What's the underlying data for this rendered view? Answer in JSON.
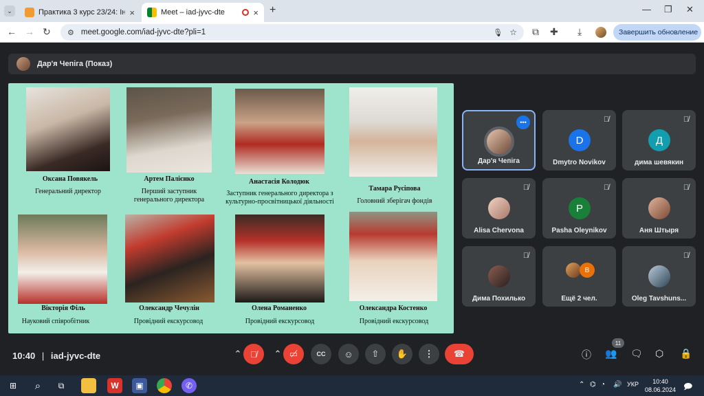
{
  "browser": {
    "tabs": [
      {
        "label": "Практика 3 курс 23/24: Індиві",
        "active": false
      },
      {
        "label": "Meet – iad-jyvc-dte",
        "active": true
      }
    ],
    "new_tab": "+",
    "address": "meet.google.com/iad-jyvc-dte?pli=1",
    "update_button": "Завершить обновление"
  },
  "meet": {
    "presenter_label": "Дар'я Чепіга (Показ)",
    "slide": {
      "background": "#9ee3cc",
      "people": [
        {
          "name": "Оксана Повякель",
          "role": "Генеральний директор"
        },
        {
          "name": "Артем Палієнко",
          "role": "Перший заступник генерального директора"
        },
        {
          "name": "Анастасія Колодюк",
          "role": "Заступник генерального директора з культурно-просвітницької діяльності"
        },
        {
          "name": "Тамара Русіпова",
          "role": "Головний зберігач фондів"
        },
        {
          "name": "Вікторія Філь",
          "role": "Науковий співробітник"
        },
        {
          "name": "Олександр Чечулін",
          "role": "Провідний екскурсовод"
        },
        {
          "name": "Олена Романенко",
          "role": "Провідний екскурсовод"
        },
        {
          "name": "Олександра Костенко",
          "role": "Провідний екскурсовод"
        }
      ]
    },
    "participants": [
      {
        "name": "Дар'я Чепіга",
        "initial": "",
        "color": "#8a6a55",
        "speaking": true
      },
      {
        "name": "Dmytro Novikov",
        "initial": "D",
        "color": "#1a73e8"
      },
      {
        "name": "дима шевякин",
        "initial": "Д",
        "color": "#129eaf"
      },
      {
        "name": "Alisa Chervona",
        "initial": "",
        "color": "#c9a393"
      },
      {
        "name": "Pasha Oleynikov",
        "initial": "P",
        "color": "#188038"
      },
      {
        "name": "Аня Штыря",
        "initial": "",
        "color": "#a7705b"
      },
      {
        "name": "Дима Похилько",
        "initial": "",
        "color": "#5a3d3a"
      },
      {
        "name": "Ещё 2 чел.",
        "initial": "B",
        "color": "#e8710a"
      },
      {
        "name": "Oleg Tavshuns...",
        "initial": "",
        "color": "#6f8aa0"
      }
    ],
    "time": "10:40",
    "separator": "|",
    "meeting_code": "iad-jyvc-dte",
    "participant_count": "11"
  },
  "taskbar": {
    "lang": "УКР",
    "time": "10:40",
    "date": "08.06.2024"
  }
}
